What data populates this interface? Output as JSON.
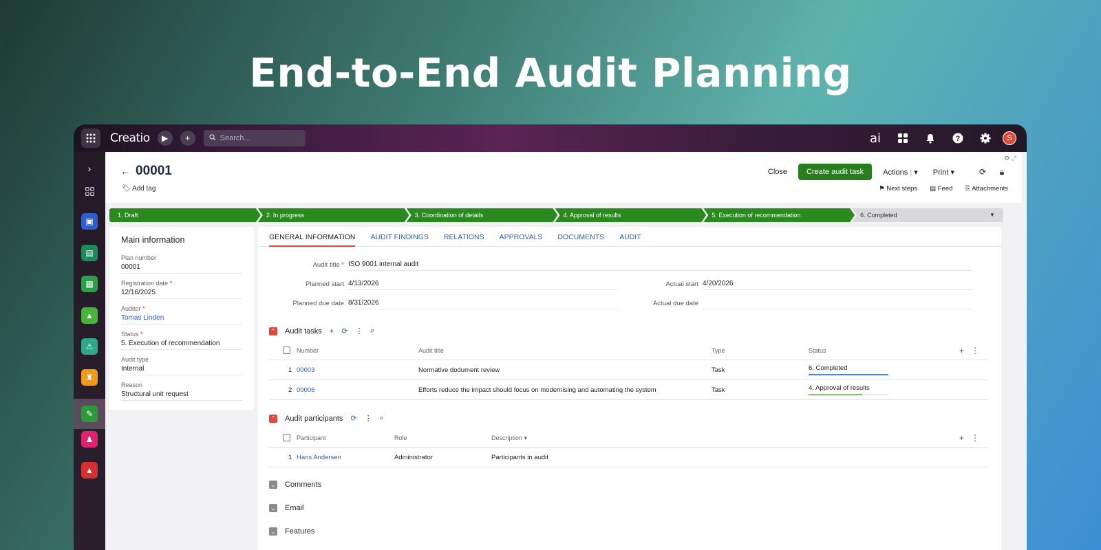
{
  "hero": {
    "title": "End-to-End Audit Planning"
  },
  "topbar": {
    "logo": "Creatio",
    "search_placeholder": "Search...",
    "ai_label": "ai",
    "avatar_letter": "S"
  },
  "record": {
    "title": "00001",
    "add_tag": "Add tag"
  },
  "header_actions": {
    "close": "Close",
    "create": "Create audit task",
    "actions": "Actions",
    "print": "Print",
    "next_steps": "Next steps",
    "feed": "Feed",
    "attachments": "Attachments"
  },
  "stages": [
    "1. Draft",
    "2. In progress",
    "3. Coordination of details",
    "4. Approval of results",
    "5. Execution of recommendation",
    "6. Completed"
  ],
  "main_info": {
    "title": "Main information",
    "fields": [
      {
        "label": "Plan number",
        "value": "00001"
      },
      {
        "label": "Registration date",
        "value": "12/16/2025"
      },
      {
        "label": "Auditor",
        "value": "Tomas Linden"
      },
      {
        "label": "Status",
        "value": "5. Execution of recommendation"
      },
      {
        "label": "Audit type",
        "value": "Internal"
      },
      {
        "label": "Reason",
        "value": "Structural unit request"
      }
    ]
  },
  "tabs": [
    "GENERAL INFORMATION",
    "AUDIT FINDINGS",
    "RELATIONS",
    "APPROVALS",
    "DOCUMENTS",
    "AUDIT"
  ],
  "general": {
    "audit_title_label": "Audit title",
    "audit_title": "ISO 9001 internal audit",
    "planned_start_label": "Planned start",
    "planned_start": "4/13/2026",
    "planned_due_label": "Planned due date",
    "planned_due": "8/31/2026",
    "actual_start_label": "Actual start",
    "actual_start": "4/20/2026",
    "actual_due_label": "Actual due date",
    "actual_due": ""
  },
  "audit_tasks": {
    "title": "Audit tasks",
    "columns": [
      "Number",
      "Audit title",
      "Type",
      "Status"
    ],
    "rows": [
      {
        "idx": "1",
        "number": "00003",
        "title": "Normative dodument review",
        "type": "Task",
        "status": "6. Completed",
        "progress": 1.0,
        "color": "#3d8fd6"
      },
      {
        "idx": "2",
        "number": "00006",
        "title": "Efforts reduce the impact should focus on modernising and automating the system",
        "type": "Task",
        "status": "4. Approval of results",
        "progress": 0.67,
        "color": "#7cc36a"
      }
    ]
  },
  "participants": {
    "title": "Audit participants",
    "columns": [
      "Participant",
      "Role",
      "Description"
    ],
    "rows": [
      {
        "idx": "1",
        "participant": "Hans Andersen",
        "role": "Administrator",
        "description": "Participants in audit"
      }
    ]
  },
  "collapsed_sections": [
    "Comments",
    "Email",
    "Features"
  ],
  "colors": {
    "accent": "#2a7d1f",
    "stage_done": "#2b8a1f",
    "stage_pending": "#d9d9dc",
    "link": "#2b5fc7",
    "required": "#d9361b"
  }
}
